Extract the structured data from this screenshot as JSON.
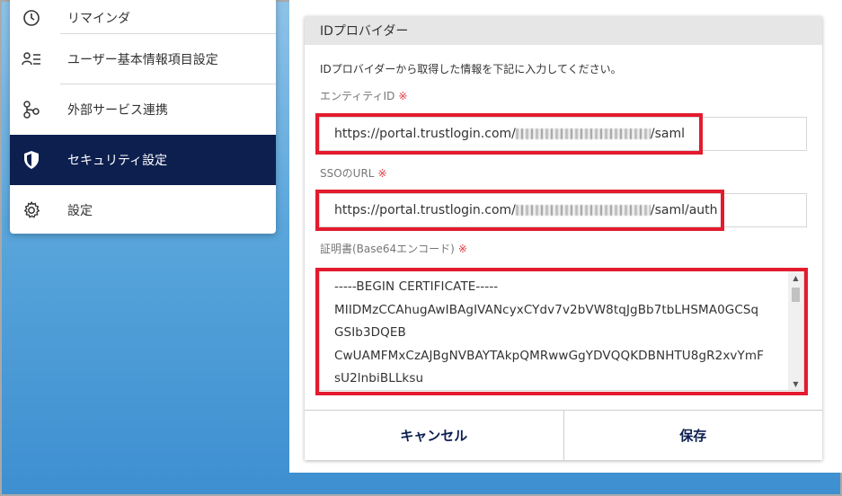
{
  "sidebar": {
    "items": [
      {
        "label": "リマインダ",
        "icon": "clock-icon",
        "active": false
      },
      {
        "label": "ユーザー基本情報項目設定",
        "icon": "user-list-icon",
        "active": false
      },
      {
        "label": "外部サービス連携",
        "icon": "link-nodes-icon",
        "active": false
      },
      {
        "label": "セキュリティ設定",
        "icon": "shield-icon",
        "active": true
      },
      {
        "label": "設定",
        "icon": "gear-icon",
        "active": false
      }
    ]
  },
  "dialog": {
    "title": "IDプロバイダー",
    "description": "IDプロバイダーから取得した情報を下記に入力してください。",
    "entity_id": {
      "label": "エンティティID",
      "required_mark": "※",
      "value_prefix": "https://portal.trustlogin.com/",
      "value_suffix": "/saml"
    },
    "sso_url": {
      "label": "SSOのURL",
      "required_mark": "※",
      "value_prefix": "https://portal.trustlogin.com/",
      "value_suffix": "/saml/auth"
    },
    "certificate": {
      "label": "証明書(Base64エンコード)",
      "required_mark": "※",
      "lines": [
        "-----BEGIN CERTIFICATE-----",
        "MIIDMzCCAhugAwIBAgIVANcyxCYdv7v2bVW8tqJgBb7tbLHSMA0GCSq",
        "GSIb3DQEB",
        "CwUAMFMxCzAJBgNVBAYTAkpQMRwwGgYDVQQKDBNHTU8gR2xvYmF",
        "sU2lnbiBLLksu"
      ]
    },
    "cancel_label": "キャンセル",
    "save_label": "保存"
  },
  "colors": {
    "accent_navy": "#0d1f4f",
    "highlight_red": "#e31b2d",
    "required_red": "#e0383e"
  }
}
